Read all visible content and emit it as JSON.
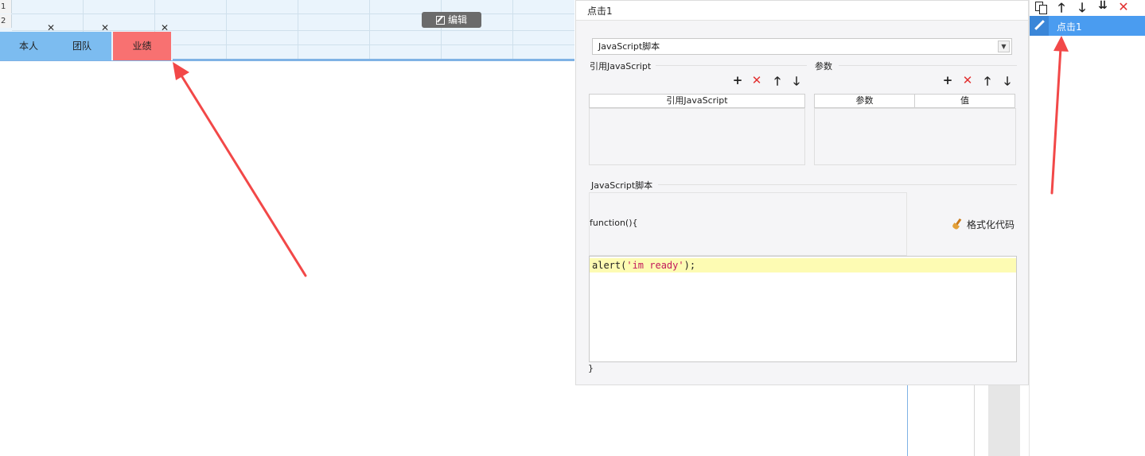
{
  "sheet": {
    "row_numbers": [
      "1",
      "2"
    ],
    "edit_button_label": "编辑",
    "tabs": [
      {
        "label": "本人",
        "close": "✕"
      },
      {
        "label": "团队",
        "close": "✕"
      },
      {
        "label": "业绩",
        "close": "✕"
      }
    ]
  },
  "dialog": {
    "title": "点击1",
    "script_type": "JavaScript脚本",
    "ref_section": {
      "title": "引用JavaScript",
      "column_header": "引用JavaScript"
    },
    "param_section": {
      "title": "参数",
      "columns": [
        "参数",
        "值"
      ]
    },
    "toolbar_icons": {
      "add": "+",
      "delete": "✕",
      "up": "🡑",
      "down": "🡓"
    },
    "script_section": {
      "title": "JavaScript脚本",
      "function_open": "function(){",
      "format_button_label": "格式化代码",
      "code_prefix": "alert(",
      "code_string": "'im ready'",
      "code_suffix": ");",
      "function_close": "}"
    }
  },
  "event_list": {
    "items": [
      {
        "label": "点击1",
        "selected": true
      }
    ]
  },
  "colors": {
    "tab_normal": "#7cbcf0",
    "tab_active": "#f87171",
    "selection_blue": "#4a9cf0",
    "delete_red": "#e23030",
    "annotation_arrow": "#f24848"
  }
}
